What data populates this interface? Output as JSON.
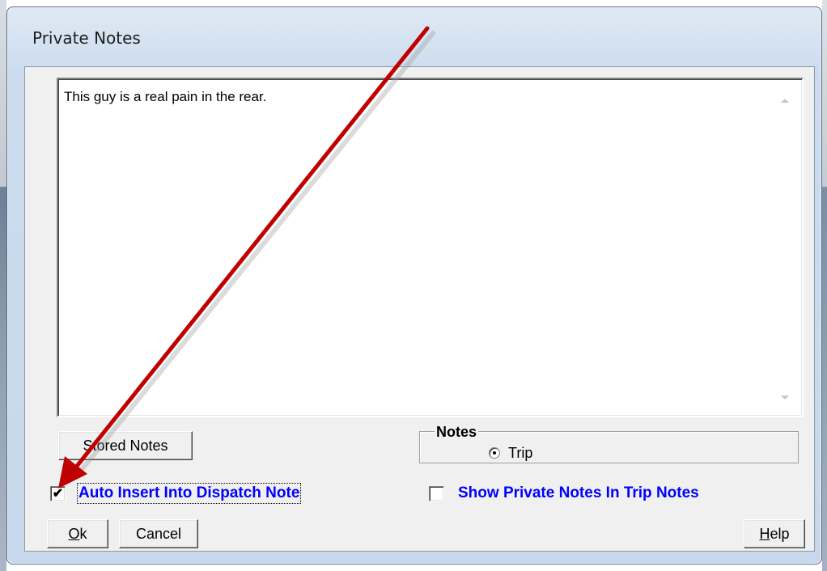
{
  "window": {
    "title": "Private Notes"
  },
  "memo": {
    "text": "This guy is a real pain in the rear."
  },
  "buttons": {
    "stored_notes": "Stored Notes",
    "ok_mnemonic": "O",
    "ok_rest": "k",
    "cancel": "Cancel",
    "help_mnemonic": "H",
    "help_rest": "elp"
  },
  "notes_group": {
    "label": "Notes",
    "options": [
      {
        "label": "Trip",
        "selected": true
      }
    ]
  },
  "options": {
    "auto_insert": {
      "label": "Auto Insert Into Dispatch Note",
      "checked": true,
      "check_glyph": "✔"
    },
    "show_private": {
      "label": "Show Private Notes In Trip Notes",
      "checked": false,
      "check_glyph": ""
    }
  },
  "annotation": {
    "arrow_color": "#c00000",
    "icon": "red-annotation-arrow"
  },
  "colors": {
    "label_blue": "#0000ff",
    "dialog_face": "#f0f0f0",
    "frame": "#ccdcee"
  }
}
